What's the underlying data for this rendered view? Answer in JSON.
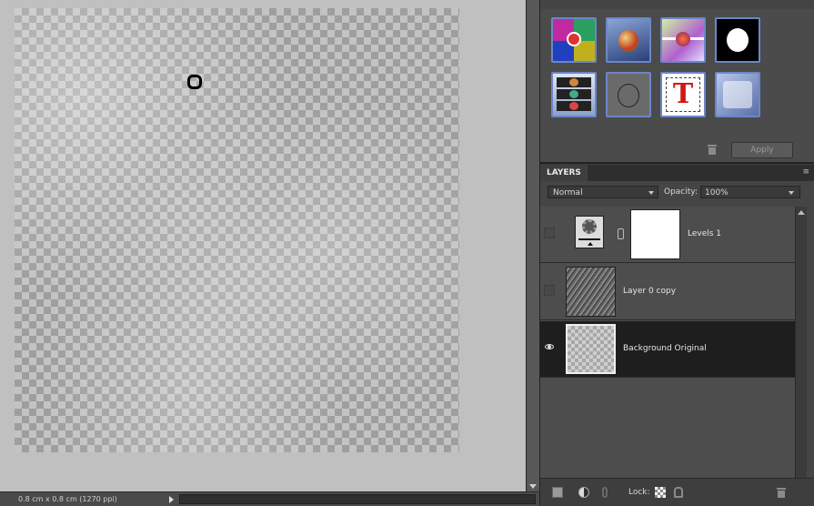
{
  "status": {
    "doc_size": "0.8 cm x 0.8 cm (1270 ppi)"
  },
  "effects": {
    "apply_label": "Apply",
    "thumbnails": [
      "color-quadrant-effect",
      "photo-cutout-effect",
      "color-glow-effect",
      "silhouette-effect",
      "film-strip-effect",
      "outline-effect",
      "text-effect",
      "glass-effect"
    ]
  },
  "layers": {
    "tab_label": "LAYERS",
    "blend_mode": "Normal",
    "opacity_label": "Opacity:",
    "opacity_value": "100%",
    "items": [
      {
        "name": "Levels 1",
        "visible": false,
        "type": "adjustment"
      },
      {
        "name": "Layer 0 copy",
        "visible": false,
        "type": "raster"
      },
      {
        "name": "Background Original",
        "visible": true,
        "type": "raster"
      }
    ],
    "lock_label": "Lock:"
  }
}
